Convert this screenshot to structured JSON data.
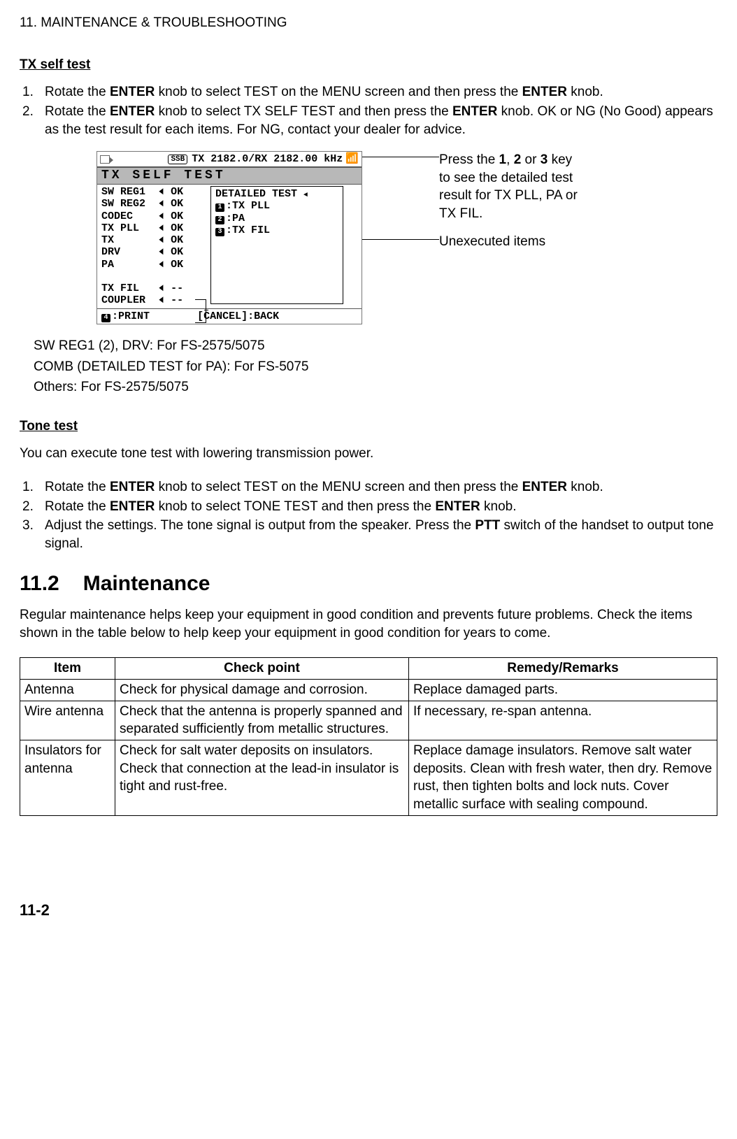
{
  "chapter_header": "11. MAINTENANCE & TROUBLESHOOTING",
  "tx_self_test": {
    "heading": "TX self test",
    "step1_pre": "Rotate the ",
    "step1_b1": "ENTER",
    "step1_mid": " knob to select TEST on the MENU screen and then press the ",
    "step1_b2": "ENTER",
    "step1_post": " knob.",
    "step2_pre": "Rotate the ",
    "step2_b1": "ENTER",
    "step2_mid": " knob to select TX SELF TEST and then press the ",
    "step2_b2": "ENTER",
    "step2_post": " knob. OK or NG (No Good) appears as the test result for each items. For NG, contact your dealer for advice."
  },
  "lcd": {
    "ssb": "SSB",
    "freq": "TX 2182.0/RX 2182.00 kHz",
    "title": "TX SELF TEST",
    "rows": [
      {
        "label": "SW REG1",
        "status": "OK"
      },
      {
        "label": "SW REG2",
        "status": "OK"
      },
      {
        "label": "CODEC",
        "status": "OK"
      },
      {
        "label": "TX PLL",
        "status": "OK"
      },
      {
        "label": "TX",
        "status": "OK"
      },
      {
        "label": "DRV",
        "status": "OK"
      },
      {
        "label": "PA",
        "status": "OK"
      }
    ],
    "blank_rows": [
      {
        "label": "TX FIL",
        "status": "--"
      },
      {
        "label": "COUPLER",
        "status": "--"
      }
    ],
    "detailed_title": "DETAILED TEST",
    "detailed_items": [
      "TX PLL",
      "PA",
      "TX FIL"
    ],
    "foot_print": "PRINT",
    "foot_back": "[CANCEL]:BACK"
  },
  "callouts": {
    "c1_pre": "Press the ",
    "c1_b1": "1",
    "c1_mid1": ", ",
    "c1_b2": "2",
    "c1_mid2": " or ",
    "c1_b3": "3",
    "c1_post": " key to see the detailed test result for TX PLL, PA or TX FIL.",
    "c2": "Unexecuted items"
  },
  "notes": {
    "n1": "SW REG1 (2), DRV: For FS-2575/5075",
    "n2": "COMB (DETAILED TEST for PA): For FS-5075",
    "n3": "Others: For FS-2575/5075"
  },
  "tone_test": {
    "heading": "Tone test",
    "intro": "You can execute tone test with lowering transmission power.",
    "s1_pre": "Rotate the ",
    "s1_b1": "ENTER",
    "s1_mid": " knob to select TEST on the MENU screen and then press the ",
    "s1_b2": "ENTER",
    "s1_post": " knob.",
    "s2_pre": "Rotate the ",
    "s2_b1": "ENTER",
    "s2_mid": " knob to select TONE TEST and then press the ",
    "s2_b2": "ENTER",
    "s2_post": " knob.",
    "s3_pre": "Adjust the settings. The tone signal is output from the speaker. Press the ",
    "s3_b1": "PTT",
    "s3_post": " switch of the handset to output tone signal."
  },
  "maintenance": {
    "heading_num": "11.2",
    "heading_text": "Maintenance",
    "intro": "Regular maintenance helps keep your equipment in good condition and prevents future problems. Check the items shown in the table below to help keep your equipment in good condition for years to come.",
    "headers": {
      "item": "Item",
      "check": "Check point",
      "remedy": "Remedy/Remarks"
    },
    "rows": [
      {
        "item": "Antenna",
        "check": "Check for physical damage and corrosion.",
        "remedy": "Replace damaged parts."
      },
      {
        "item": "Wire antenna",
        "check": "Check that the antenna is properly spanned and separated sufficiently from metallic structures.",
        "remedy": "If necessary, re-span antenna."
      },
      {
        "item": "Insulators for antenna",
        "check": "Check for salt water deposits on insulators. Check that connection at the lead-in insulator is tight and rust-free.",
        "remedy": "Replace damage insulators. Remove salt water deposits. Clean with fresh water, then dry. Remove rust, then tighten bolts and lock nuts. Cover metallic surface with sealing compound."
      }
    ]
  },
  "page_number": "11-2"
}
